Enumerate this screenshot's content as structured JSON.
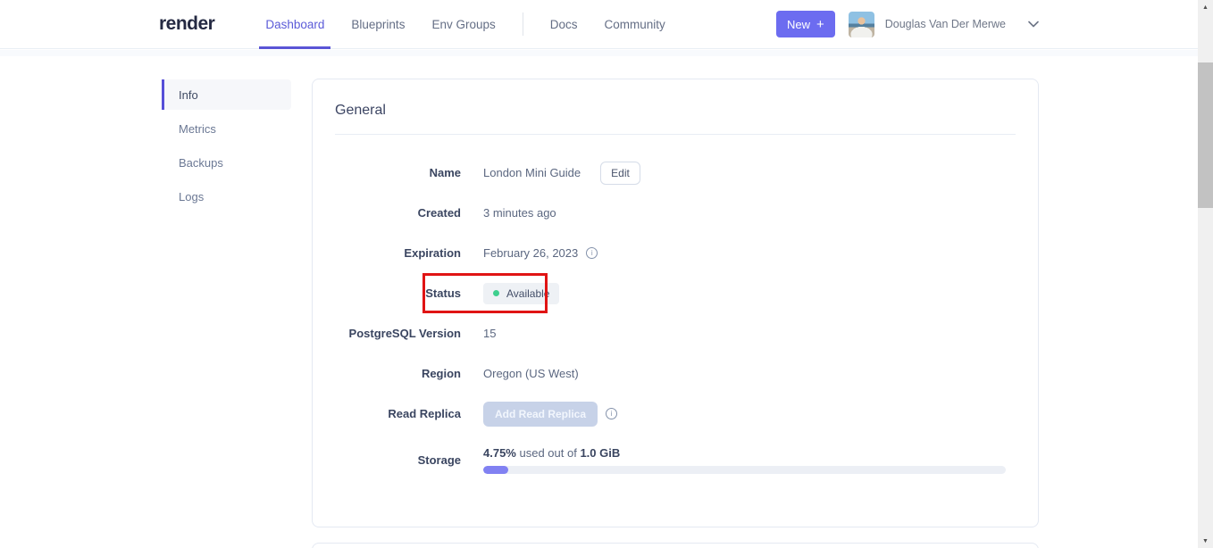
{
  "header": {
    "logo": "render",
    "nav": [
      {
        "label": "Dashboard",
        "active": true
      },
      {
        "label": "Blueprints",
        "active": false
      },
      {
        "label": "Env Groups",
        "active": false
      },
      {
        "label": "Docs",
        "active": false
      },
      {
        "label": "Community",
        "active": false
      }
    ],
    "new_button": {
      "label": "New",
      "icon": "+"
    },
    "user_name": "Douglas Van Der Merwe"
  },
  "sidebar": {
    "items": [
      {
        "label": "Info",
        "active": true
      },
      {
        "label": "Metrics",
        "active": false
      },
      {
        "label": "Backups",
        "active": false
      },
      {
        "label": "Logs",
        "active": false
      }
    ]
  },
  "general": {
    "title": "General",
    "name": {
      "label": "Name",
      "value": "London Mini Guide",
      "edit_button": "Edit"
    },
    "created": {
      "label": "Created",
      "value": "3 minutes ago"
    },
    "expiration": {
      "label": "Expiration",
      "value": "February 26, 2023"
    },
    "status": {
      "label": "Status",
      "value": "Available"
    },
    "version": {
      "label": "PostgreSQL Version",
      "value": "15"
    },
    "region": {
      "label": "Region",
      "value": "Oregon (US West)"
    },
    "read_replica": {
      "label": "Read Replica",
      "button": "Add Read Replica"
    },
    "storage": {
      "label": "Storage",
      "used": "4.75%",
      "middle": " used out of ",
      "total": "1.0 GiB",
      "progress_percent": 4.75
    }
  },
  "icons": {
    "info": "i"
  },
  "colors": {
    "accent": "#6c6cf0",
    "annotation_red": "#e01414",
    "status_green": "#3ecf8e"
  }
}
